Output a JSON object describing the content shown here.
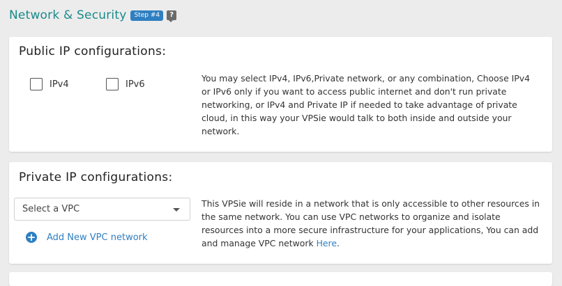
{
  "section": {
    "title": "Network & Security",
    "step_badge": "Step #4",
    "help_icon": "question-mark-icon"
  },
  "public_ip": {
    "heading": "Public IP configurations:",
    "options": [
      {
        "label": "IPv4",
        "checked": false
      },
      {
        "label": "IPv6",
        "checked": false
      }
    ],
    "description": "You may select IPv4, IPv6,Private network, or any combination, Choose IPv4 or IPv6 only if you want to access public internet and don't run private networking, or IPv4 and Private IP if needed to take advantage of private cloud, in this way your VPSie would talk to both inside and outside your network."
  },
  "private_ip": {
    "heading": "Private IP configurations:",
    "vpc_select_placeholder": "Select a VPC",
    "add_vpc_label": "Add New VPC network",
    "description": "This VPSie will reside in a network that is only accessible to other resources in the same network. You can use VPC networks to organize and isolate resources into a more secure infrastructure for your applications, You can add and manage VPC network",
    "description_link": "Here",
    "description_end": "."
  },
  "colors": {
    "accent_teal": "#1a8a8a",
    "link_blue": "#2f7fc1"
  }
}
